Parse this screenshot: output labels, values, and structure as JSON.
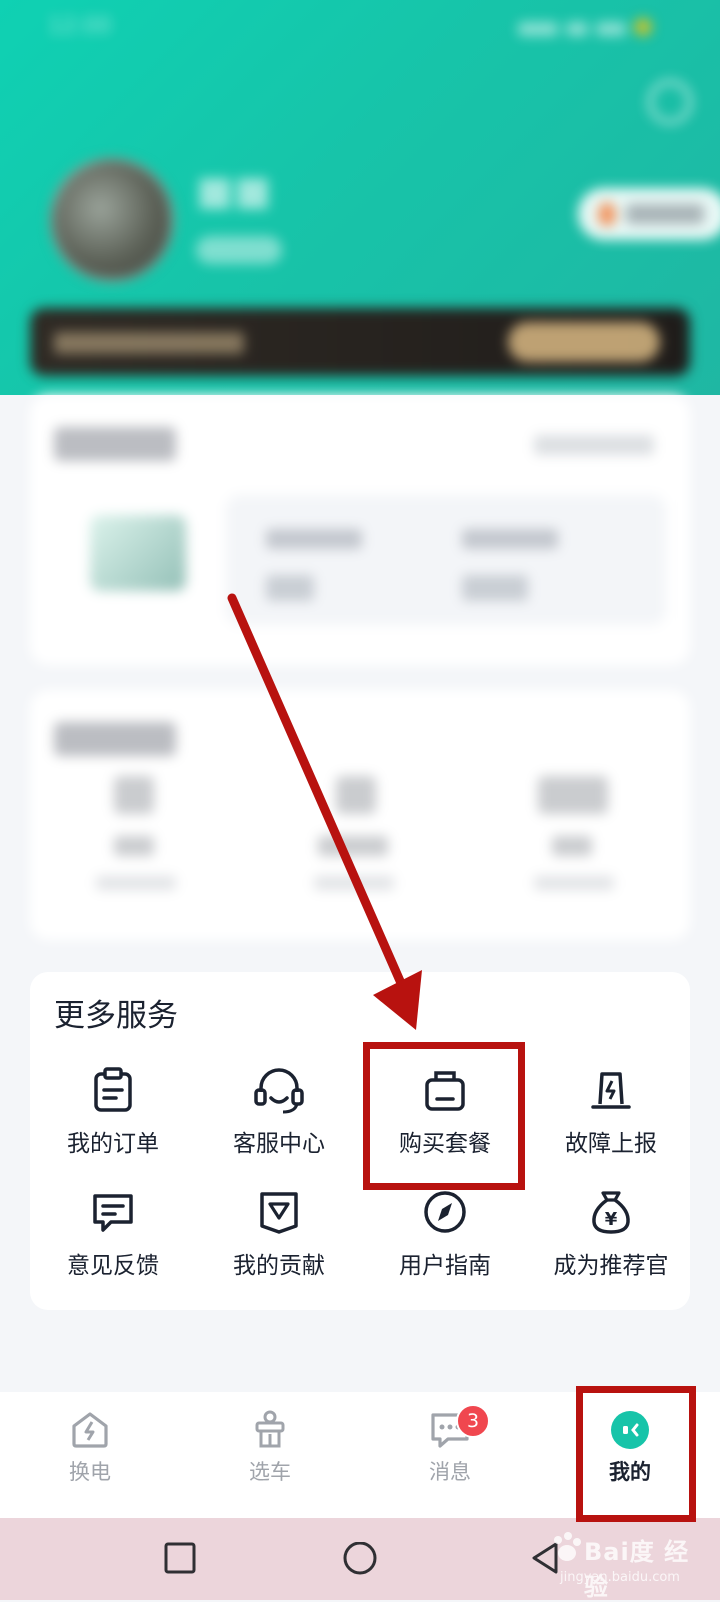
{
  "services": {
    "title": "更多服务",
    "items": [
      {
        "label": "我的订单",
        "icon": "clipboard-icon"
      },
      {
        "label": "客服中心",
        "icon": "headset-icon"
      },
      {
        "label": "购买套餐",
        "icon": "package-bag-icon"
      },
      {
        "label": "故障上报",
        "icon": "alarm-light-icon"
      },
      {
        "label": "意见反馈",
        "icon": "feedback-message-icon"
      },
      {
        "label": "我的贡献",
        "icon": "contribution-badge-icon"
      },
      {
        "label": "用户指南",
        "icon": "compass-icon"
      },
      {
        "label": "成为推荐官",
        "icon": "money-bag-icon"
      }
    ]
  },
  "tabbar": {
    "tabs": [
      {
        "label": "换电",
        "icon": "battery-swap-icon",
        "active": false
      },
      {
        "label": "选车",
        "icon": "vehicle-icon",
        "active": false
      },
      {
        "label": "消息",
        "icon": "message-icon",
        "active": false,
        "badge": "3"
      },
      {
        "label": "我的",
        "icon": "profile-icon",
        "active": true
      }
    ]
  },
  "system_nav": [
    "recent-apps-icon",
    "home-icon",
    "back-icon"
  ],
  "colors": {
    "header_gradient_start": "#0fd1b3",
    "header_gradient_end": "#1fb7a3",
    "accent": "#17c4a9",
    "annotation_red": "#b8120f",
    "badge_red": "#f0474f"
  },
  "watermark": {
    "brand": "Bai度 经验",
    "url": "jingyan.baidu.com"
  }
}
